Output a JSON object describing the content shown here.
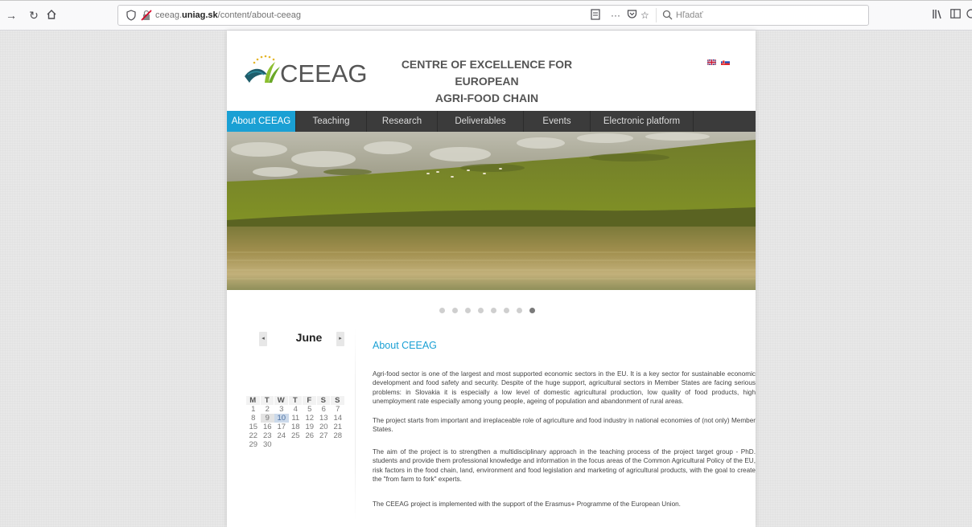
{
  "browser": {
    "url_domain": "ceeag.",
    "url_host_bold": "uniag.sk",
    "url_path": "/content/about-ceeag",
    "search_placeholder": "Hľadať",
    "more_label": "···"
  },
  "site": {
    "logo_text": "CEEAG",
    "title_line1": "CENTRE OF EXCELLENCE FOR EUROPEAN",
    "title_line2": "AGRI-FOOD CHAIN"
  },
  "nav": {
    "items": [
      {
        "label": "About CEEAG",
        "active": true
      },
      {
        "label": "Teaching"
      },
      {
        "label": "Research"
      },
      {
        "label": "Deliverables"
      },
      {
        "label": "Events"
      },
      {
        "label": "Electronic platform"
      }
    ]
  },
  "slider": {
    "dot_count": 8,
    "active_index": 7
  },
  "calendar": {
    "month": "June",
    "prev": "◂",
    "next": "▸",
    "weekdays": [
      "M",
      "T",
      "W",
      "T",
      "F",
      "S",
      "S"
    ],
    "weeks": [
      [
        "1",
        "2",
        "3",
        "4",
        "5",
        "6",
        "7"
      ],
      [
        "8",
        "9",
        "10",
        "11",
        "12",
        "13",
        "14"
      ],
      [
        "15",
        "16",
        "17",
        "18",
        "19",
        "20",
        "21"
      ],
      [
        "22",
        "23",
        "24",
        "25",
        "26",
        "27",
        "28"
      ],
      [
        "29",
        "30",
        "",
        "",
        "",
        "",
        ""
      ]
    ],
    "today": "10"
  },
  "content": {
    "title": "About CEEAG",
    "p1": "Agri-food sector is one of the largest and most supported economic sectors in the EU. It is a key sector for sustainable economic development and food safety and security. Despite of the huge support, agricultural sectors in Member States are facing serious problems: in Slovakia it is especially a low level of domestic agricultural production, low quality of food products, high unemployment rate especially among young people, ageing of population and abandonment of rural areas.",
    "p2": "The project starts from important and irreplaceable role of agriculture and food industry in national economies of (not only) Member States.",
    "p3": "The aim of the project is to strengthen a multidisciplinary approach in the teaching process of the project target group - PhD. students and provide them professional knowledge and information in the focus areas of the Common Agricultural Policy of the EU, risk factors in the food chain, land, environment and food legislation and marketing of agricultural products, with the goal to create the \"from farm to fork\" experts.",
    "p4": "The CEEAG project is implemented with the support of the Erasmus+ Programme of the European Union."
  },
  "colors": {
    "accent": "#1aa0d4",
    "nav_bg": "#3b3b3b"
  }
}
